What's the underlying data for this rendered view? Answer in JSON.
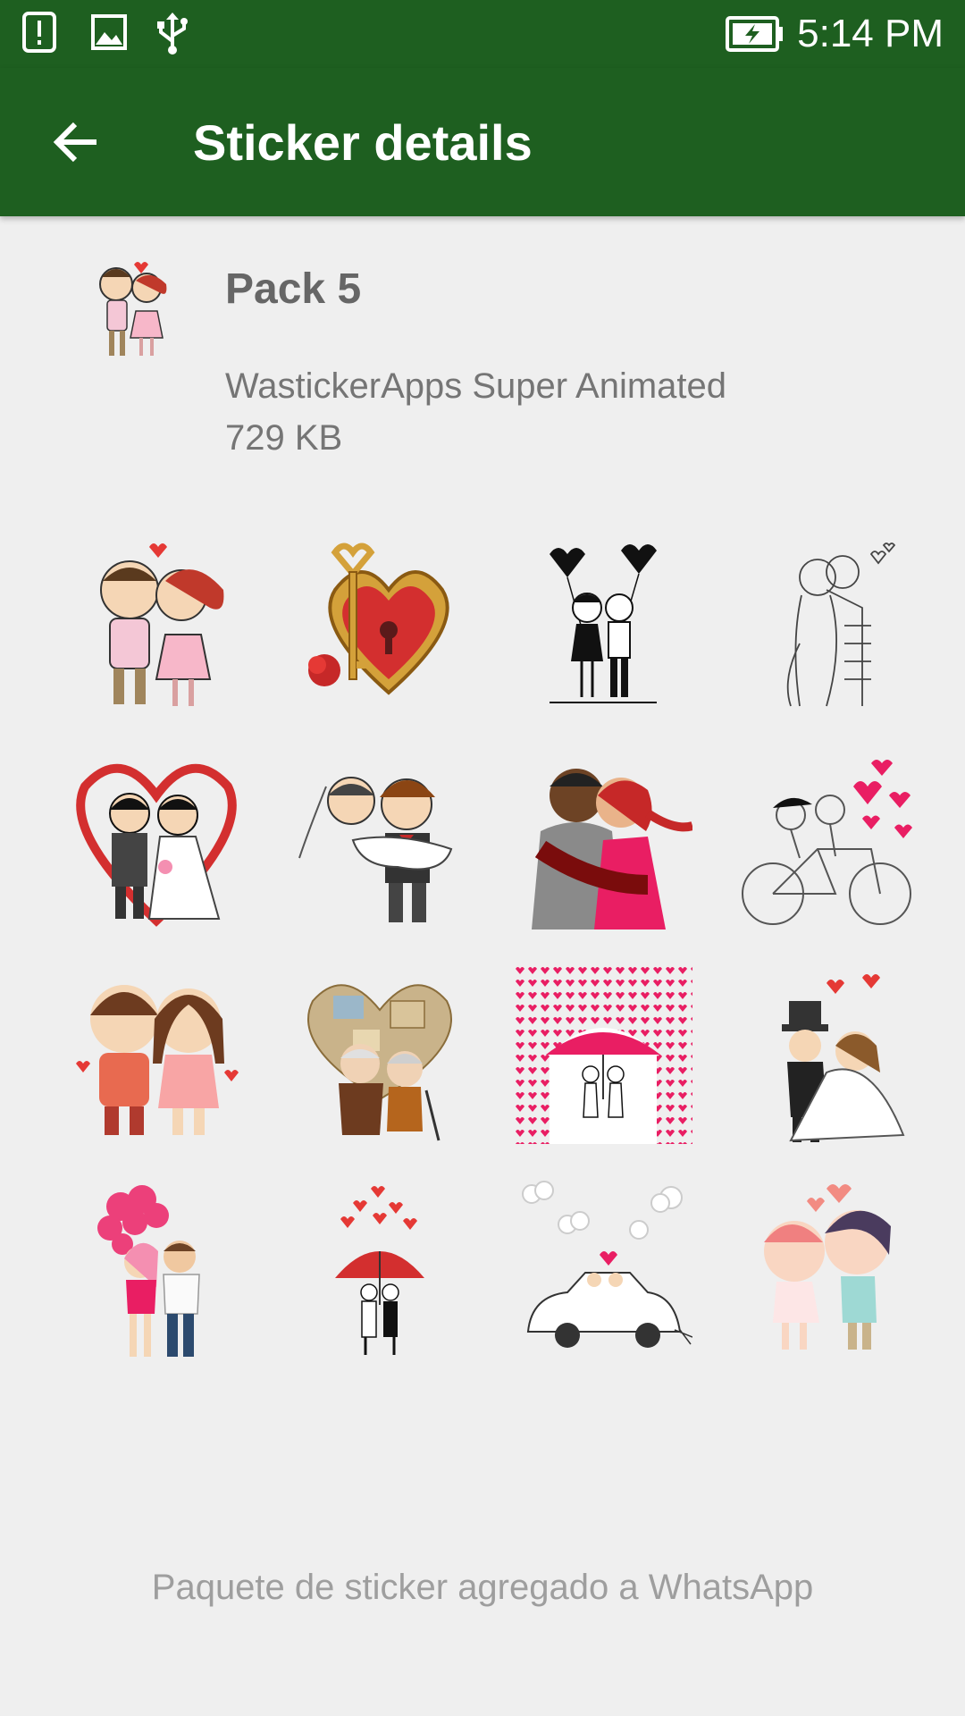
{
  "status_bar": {
    "icons": [
      "alert-icon",
      "image-icon",
      "usb-icon",
      "battery-charging-icon"
    ],
    "time": "5:14 PM"
  },
  "app_bar": {
    "title": "Sticker details",
    "back_icon": "arrow-back-icon",
    "background": "#1e5f20"
  },
  "pack": {
    "name": "Pack 5",
    "publisher": "WastickerApps Super Animated",
    "size": "729 KB"
  },
  "stickers": [
    {
      "name": "couple-kiss-sticker"
    },
    {
      "name": "heart-lock-key-sticker"
    },
    {
      "name": "balloon-couple-sticker"
    },
    {
      "name": "sketch-hug-sticker"
    },
    {
      "name": "heart-wedding-couple-sticker"
    },
    {
      "name": "bride-carry-sticker"
    },
    {
      "name": "embrace-couple-sticker"
    },
    {
      "name": "bicycle-couple-sticker"
    },
    {
      "name": "cute-couple-sticker"
    },
    {
      "name": "elderly-couple-sticker"
    },
    {
      "name": "umbrella-hearts-sticker"
    },
    {
      "name": "wedding-dance-sticker"
    },
    {
      "name": "pink-balloons-couple-sticker"
    },
    {
      "name": "red-umbrella-couple-sticker"
    },
    {
      "name": "wedding-car-sticker"
    },
    {
      "name": "kiss-hearts-sticker"
    }
  ],
  "footer": {
    "message": "Paquete de sticker agregado a WhatsApp"
  }
}
